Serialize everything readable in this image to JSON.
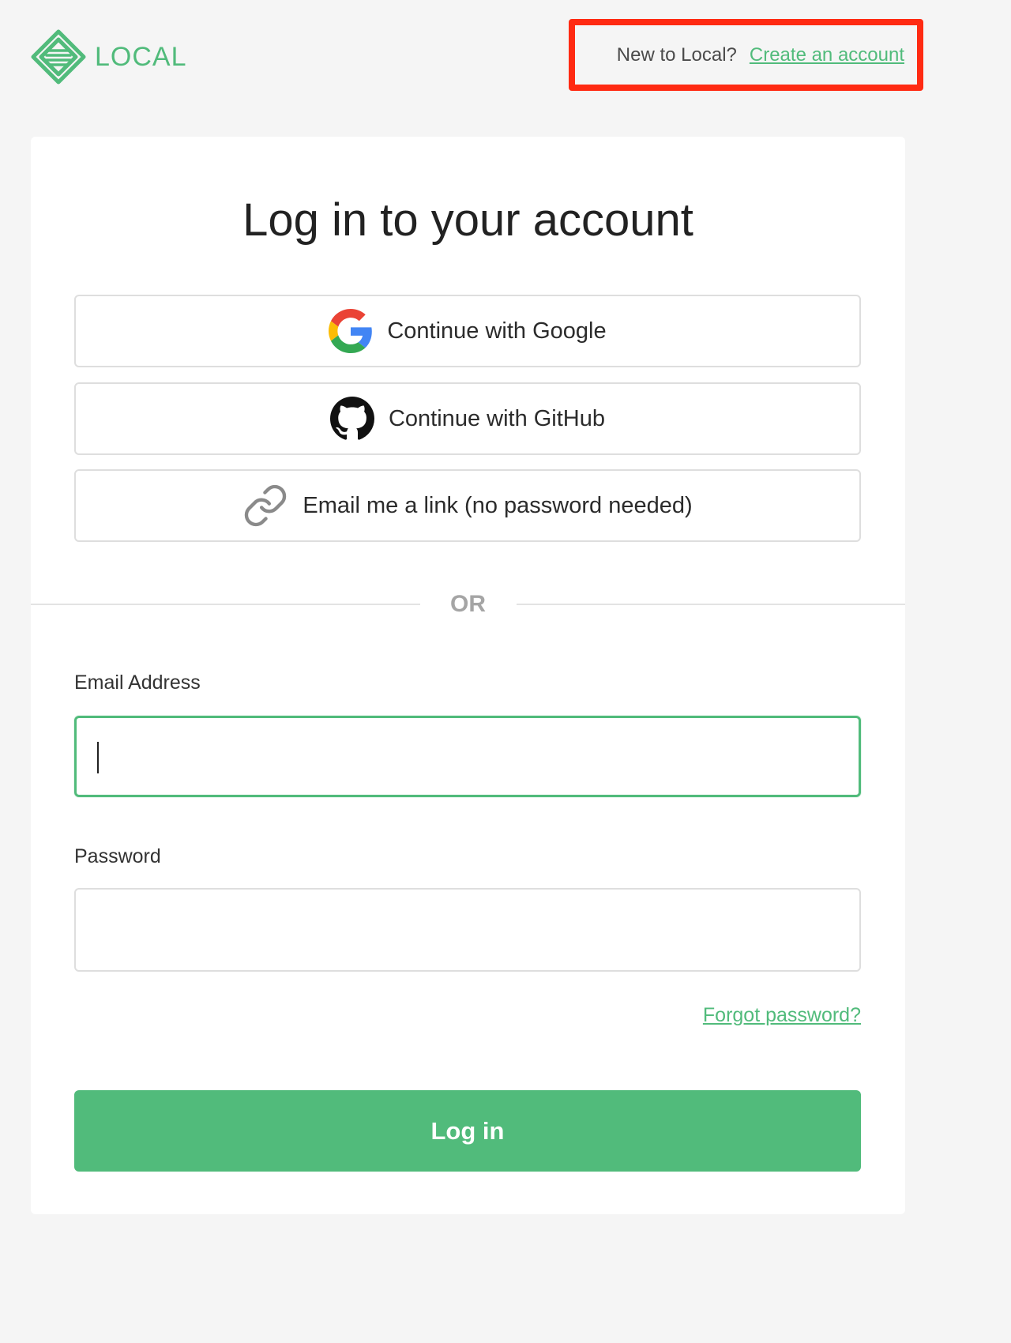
{
  "header": {
    "logo_text": "LOCAL",
    "signup_prompt": "New to Local?",
    "signup_link": "Create an account"
  },
  "card": {
    "title": "Log in to your account",
    "sso": {
      "google_label": "Continue with Google",
      "github_label": "Continue with GitHub",
      "email_link_label": "Email me a link (no password needed)"
    },
    "divider_text": "OR",
    "email_label": "Email Address",
    "email_value": "",
    "password_label": "Password",
    "password_value": "",
    "forgot_password": "Forgot password?",
    "login_button": "Log in"
  },
  "colors": {
    "brand_green": "#51bb7b",
    "highlight_red": "#ff2a12",
    "background": "#f5f5f5"
  },
  "icons": [
    "local-logo-icon",
    "google-icon",
    "github-icon",
    "link-icon"
  ]
}
